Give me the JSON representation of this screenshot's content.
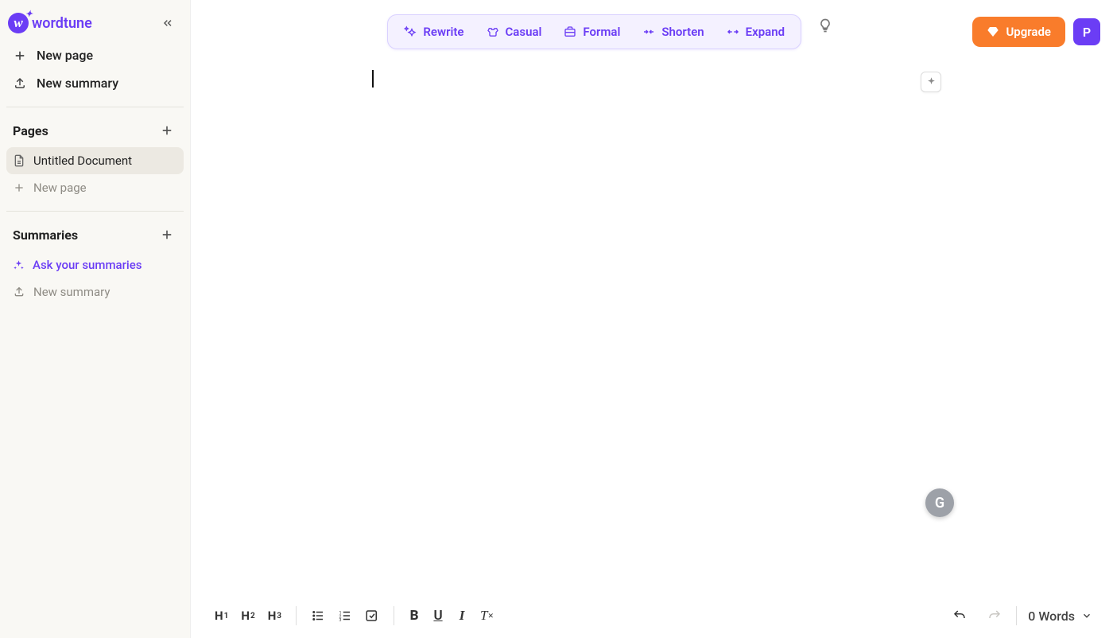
{
  "brand": {
    "name": "wordtune",
    "avatar_letter": "P"
  },
  "sidebar": {
    "new_page": "New page",
    "new_summary": "New summary",
    "pages_label": "Pages",
    "pages": [
      {
        "title": "Untitled Document",
        "active": true
      }
    ],
    "new_page_muted": "New page",
    "summaries_label": "Summaries",
    "ask_summaries": "Ask your summaries",
    "new_summary_muted": "New summary"
  },
  "toolbar": {
    "rewrite": "Rewrite",
    "casual": "Casual",
    "formal": "Formal",
    "shorten": "Shorten",
    "expand": "Expand",
    "upgrade": "Upgrade"
  },
  "format": {
    "h1": "H",
    "h1_sub": "1",
    "h2": "H",
    "h2_sub": "2",
    "h3": "H",
    "h3_sub": "3"
  },
  "status": {
    "word_count": "0 Words"
  },
  "extension": {
    "letter": "G"
  }
}
